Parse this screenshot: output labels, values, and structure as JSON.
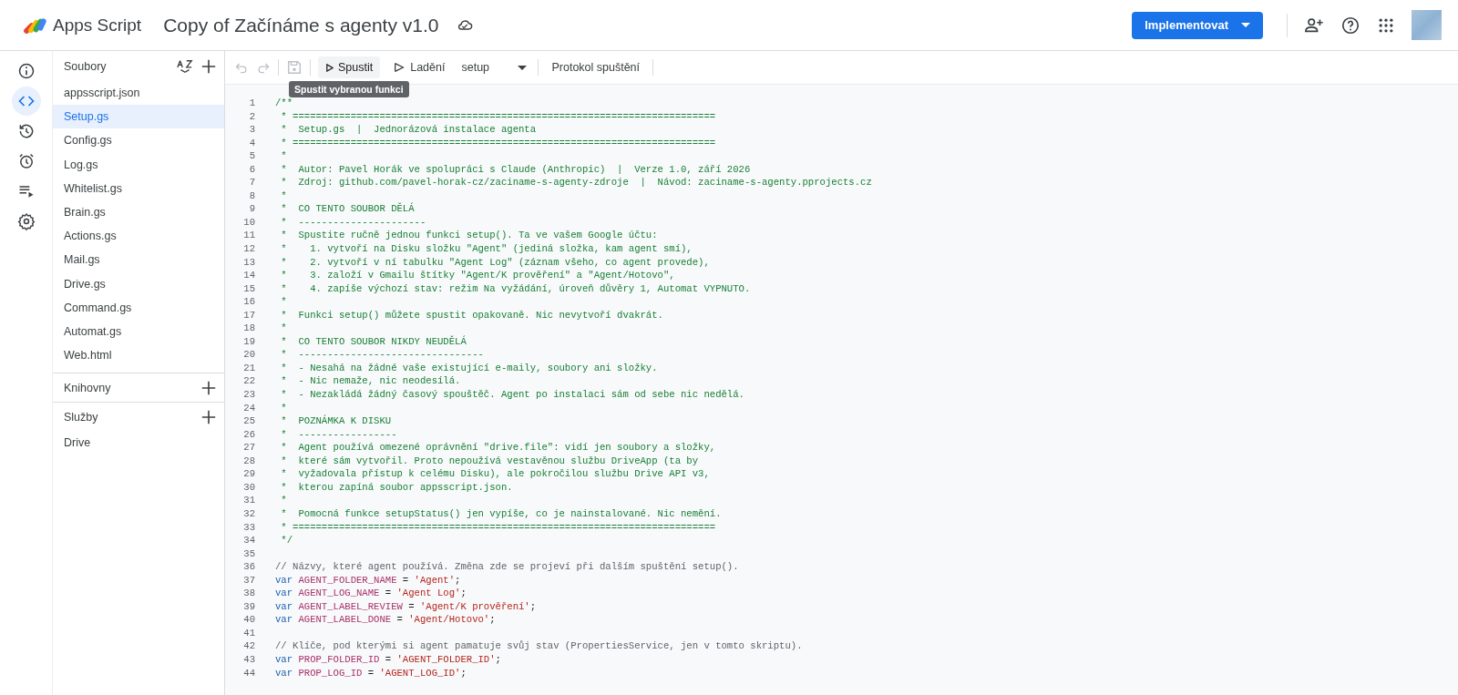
{
  "header": {
    "product": "Apps Script",
    "project_title": "Copy of Začínáme s agenty v1.0",
    "deploy_button": "Implementovat"
  },
  "rail": [
    {
      "kind": "info",
      "selected": false
    },
    {
      "kind": "code",
      "selected": true
    },
    {
      "kind": "history",
      "selected": false
    },
    {
      "kind": "triggers",
      "selected": false
    },
    {
      "kind": "executions",
      "selected": false
    },
    {
      "kind": "settings",
      "selected": false
    }
  ],
  "files_panel": {
    "title": "Soubory",
    "files": [
      {
        "name": "appsscript.json",
        "selected": false
      },
      {
        "name": "Setup.gs",
        "selected": true
      },
      {
        "name": "Config.gs",
        "selected": false
      },
      {
        "name": "Log.gs",
        "selected": false
      },
      {
        "name": "Whitelist.gs",
        "selected": false
      },
      {
        "name": "Brain.gs",
        "selected": false
      },
      {
        "name": "Actions.gs",
        "selected": false
      },
      {
        "name": "Mail.gs",
        "selected": false
      },
      {
        "name": "Drive.gs",
        "selected": false
      },
      {
        "name": "Command.gs",
        "selected": false
      },
      {
        "name": "Automat.gs",
        "selected": false
      },
      {
        "name": "Web.html",
        "selected": false
      }
    ],
    "sections": [
      {
        "title": "Knihovny"
      },
      {
        "title": "Služby",
        "items": [
          "Drive"
        ]
      }
    ]
  },
  "toolbar": {
    "undo_disabled": true,
    "redo_disabled": true,
    "save_disabled": true,
    "run_button": "Spustit",
    "debug_button": "Ladění",
    "function_select": "setup",
    "log_button": "Protokol spuštění",
    "tooltip": "Spustit vybranou funkci"
  },
  "code_lines": [
    {
      "number": "1",
      "tokens": [
        {
          "kind": "doc",
          "text": "/**"
        }
      ]
    },
    {
      "number": "2",
      "tokens": [
        {
          "kind": "doc",
          "text": " * ========================================================================="
        }
      ]
    },
    {
      "number": "3",
      "tokens": [
        {
          "kind": "doc",
          "text": " *  Setup.gs  |  Jednorázová instalace agenta"
        }
      ]
    },
    {
      "number": "4",
      "tokens": [
        {
          "kind": "doc",
          "text": " * ========================================================================="
        }
      ]
    },
    {
      "number": "5",
      "tokens": [
        {
          "kind": "doc",
          "text": " *"
        }
      ]
    },
    {
      "number": "6",
      "tokens": [
        {
          "kind": "doc",
          "text": " *  Autor: Pavel Horák ve spolupráci s Claude (Anthropic)  |  Verze 1.0, září 2026"
        }
      ]
    },
    {
      "number": "7",
      "tokens": [
        {
          "kind": "doc",
          "text": " *  Zdroj: github.com/pavel-horak-cz/zaciname-s-agenty-zdroje  |  Návod: zaciname-s-agenty.pprojects.cz"
        }
      ]
    },
    {
      "number": "8",
      "tokens": [
        {
          "kind": "doc",
          "text": " *"
        }
      ]
    },
    {
      "number": "9",
      "tokens": [
        {
          "kind": "doc",
          "text": " *  CO TENTO SOUBOR DĚLÁ"
        }
      ]
    },
    {
      "number": "10",
      "tokens": [
        {
          "kind": "doc",
          "text": " *  ----------------------"
        }
      ]
    },
    {
      "number": "11",
      "tokens": [
        {
          "kind": "doc",
          "text": " *  Spustite ručně jednou funkci setup(). Ta ve vašem Google účtu:"
        }
      ]
    },
    {
      "number": "12",
      "tokens": [
        {
          "kind": "doc",
          "text": " *    1. vytvoří na Disku složku \"Agent\" (jediná složka, kam agent smí),"
        }
      ]
    },
    {
      "number": "13",
      "tokens": [
        {
          "kind": "doc",
          "text": " *    2. vytvoří v ní tabulku \"Agent Log\" (záznam všeho, co agent provede),"
        }
      ]
    },
    {
      "number": "14",
      "tokens": [
        {
          "kind": "doc",
          "text": " *    3. založí v Gmailu štítky \"Agent/K prověření\" a \"Agent/Hotovo\","
        }
      ]
    },
    {
      "number": "15",
      "tokens": [
        {
          "kind": "doc",
          "text": " *    4. zapíše výchozí stav: režim Na vyžádání, úroveň důvěry 1, Automat VYPNUTO."
        }
      ]
    },
    {
      "number": "16",
      "tokens": [
        {
          "kind": "doc",
          "text": " *"
        }
      ]
    },
    {
      "number": "17",
      "tokens": [
        {
          "kind": "doc",
          "text": " *  Funkci setup() můžete spustit opakovaně. Nic nevytvoří dvakrát."
        }
      ]
    },
    {
      "number": "18",
      "tokens": [
        {
          "kind": "doc",
          "text": " *"
        }
      ]
    },
    {
      "number": "19",
      "tokens": [
        {
          "kind": "doc",
          "text": " *  CO TENTO SOUBOR NIKDY NEUDĚLÁ"
        }
      ]
    },
    {
      "number": "20",
      "tokens": [
        {
          "kind": "doc",
          "text": " *  --------------------------------"
        }
      ]
    },
    {
      "number": "21",
      "tokens": [
        {
          "kind": "doc",
          "text": " *  - Nesahá na žádné vaše existující e-maily, soubory ani složky."
        }
      ]
    },
    {
      "number": "22",
      "tokens": [
        {
          "kind": "doc",
          "text": " *  - Nic nemaže, nic neodesílá."
        }
      ]
    },
    {
      "number": "23",
      "tokens": [
        {
          "kind": "doc",
          "text": " *  - Nezakládá žádný časový spouštěč. Agent po instalaci sám od sebe nic nedělá."
        }
      ]
    },
    {
      "number": "24",
      "tokens": [
        {
          "kind": "doc",
          "text": " *"
        }
      ]
    },
    {
      "number": "25",
      "tokens": [
        {
          "kind": "doc",
          "text": " *  POZNÁMKA K DISKU"
        }
      ]
    },
    {
      "number": "26",
      "tokens": [
        {
          "kind": "doc",
          "text": " *  -----------------"
        }
      ]
    },
    {
      "number": "27",
      "tokens": [
        {
          "kind": "doc",
          "text": " *  Agent používá omezené oprávnění \"drive.file\": vidí jen soubory a složky,"
        }
      ]
    },
    {
      "number": "28",
      "tokens": [
        {
          "kind": "doc",
          "text": " *  které sám vytvořil. Proto nepoužívá vestavěnou službu DriveApp (ta by"
        }
      ]
    },
    {
      "number": "29",
      "tokens": [
        {
          "kind": "doc",
          "text": " *  vyžadovala přístup k celému Disku), ale pokročilou službu Drive API v3,"
        }
      ]
    },
    {
      "number": "30",
      "tokens": [
        {
          "kind": "doc",
          "text": " *  kterou zapíná soubor appsscript.json."
        }
      ]
    },
    {
      "number": "31",
      "tokens": [
        {
          "kind": "doc",
          "text": " *"
        }
      ]
    },
    {
      "number": "32",
      "tokens": [
        {
          "kind": "doc",
          "text": " *  Pomocná funkce setupStatus() jen vypíše, co je nainstalované. Nic nemění."
        }
      ]
    },
    {
      "number": "33",
      "tokens": [
        {
          "kind": "doc",
          "text": " * ========================================================================="
        }
      ]
    },
    {
      "number": "34",
      "tokens": [
        {
          "kind": "doc",
          "text": " */"
        }
      ]
    },
    {
      "number": "35"
    },
    {
      "number": "36",
      "tokens": [
        {
          "kind": "comment",
          "text": "// Názvy, které agent používá. Změna zde se projeví při dalším spuštění setup()."
        }
      ]
    },
    {
      "number": "37",
      "tokens": [
        {
          "kind": "keyword",
          "text": "var"
        },
        {
          "kind": "name",
          "text": "AGENT_FOLDER_NAME"
        },
        {
          "kind": "plain",
          "text": " = "
        },
        {
          "kind": "string",
          "text": "'Agent'"
        },
        {
          "kind": "plain",
          "text": ";"
        }
      ]
    },
    {
      "number": "38",
      "tokens": [
        {
          "kind": "keyword",
          "text": "var"
        },
        {
          "kind": "name",
          "text": "AGENT_LOG_NAME"
        },
        {
          "kind": "plain",
          "text": " = "
        },
        {
          "kind": "string",
          "text": "'Agent Log'"
        },
        {
          "kind": "plain",
          "text": ";"
        }
      ]
    },
    {
      "number": "39",
      "tokens": [
        {
          "kind": "keyword",
          "text": "var"
        },
        {
          "kind": "name",
          "text": "AGENT_LABEL_REVIEW"
        },
        {
          "kind": "plain",
          "text": " = "
        },
        {
          "kind": "string",
          "text": "'Agent/K prověření'"
        },
        {
          "kind": "plain",
          "text": ";"
        }
      ]
    },
    {
      "number": "40",
      "tokens": [
        {
          "kind": "keyword",
          "text": "var"
        },
        {
          "kind": "name",
          "text": "AGENT_LABEL_DONE"
        },
        {
          "kind": "plain",
          "text": " = "
        },
        {
          "kind": "string",
          "text": "'Agent/Hotovo'"
        },
        {
          "kind": "plain",
          "text": ";"
        }
      ]
    },
    {
      "number": "41"
    },
    {
      "number": "42",
      "tokens": [
        {
          "kind": "comment",
          "text": "// Klíče, pod kterými si agent pamatuje svůj stav (PropertiesService, jen v tomto skriptu)."
        }
      ]
    },
    {
      "number": "43",
      "tokens": [
        {
          "kind": "keyword",
          "text": "var"
        },
        {
          "kind": "name",
          "text": "PROP_FOLDER_ID"
        },
        {
          "kind": "plain",
          "text": " = "
        },
        {
          "kind": "string",
          "text": "'AGENT_FOLDER_ID'"
        },
        {
          "kind": "plain",
          "text": ";"
        }
      ]
    },
    {
      "number": "44",
      "tokens": [
        {
          "kind": "keyword",
          "text": "var"
        },
        {
          "kind": "name",
          "text": "PROP_LOG_ID"
        },
        {
          "kind": "plain",
          "text": " = "
        },
        {
          "kind": "string",
          "text": "'AGENT_LOG_ID'"
        },
        {
          "kind": "plain",
          "text": ";"
        }
      ]
    }
  ]
}
